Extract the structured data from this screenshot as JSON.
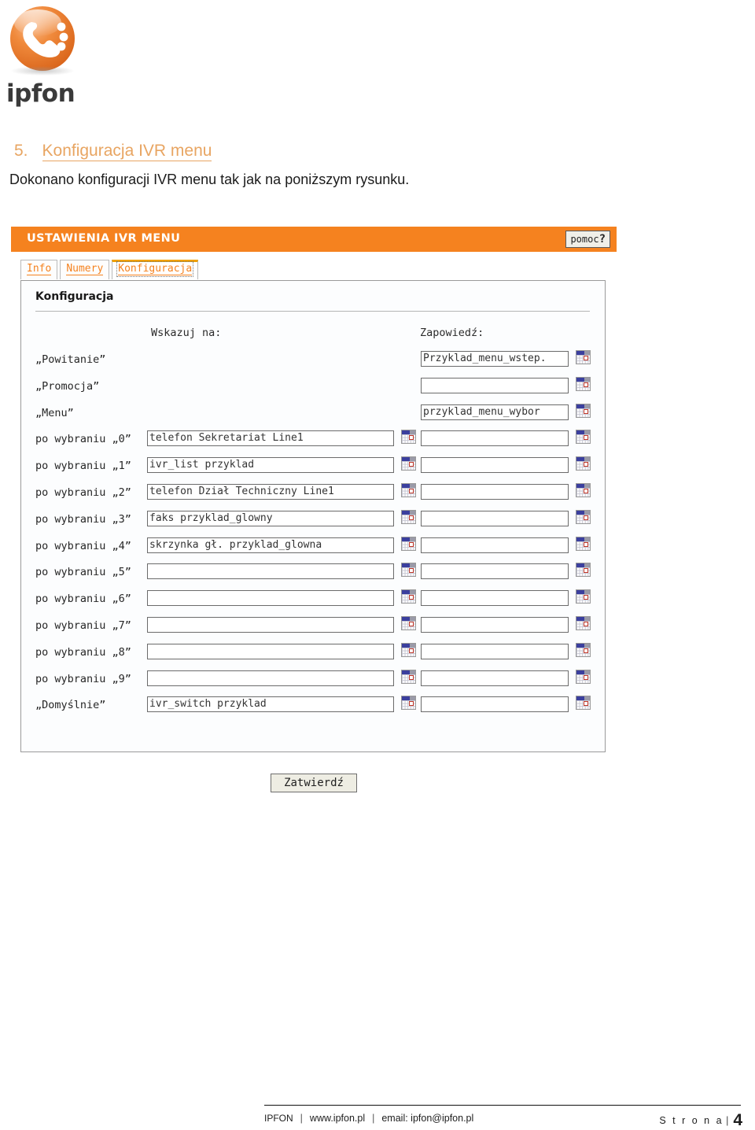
{
  "document": {
    "logo": {
      "wordmark": "ipfon",
      "icon": "ipfon-phone-sphere-logo"
    },
    "section": {
      "number": "5.",
      "title": "Konfiguracja IVR menu",
      "paragraph": "Dokonano konfiguracji IVR menu tak jak na poniższym rysunku.",
      "accent_color": "#e8a562"
    },
    "footer": {
      "brand": "IPFON",
      "website": "www.ipfon.pl",
      "email": "email: ipfon@ipfon.pl",
      "separator": "|",
      "page_label": "S t r o n a",
      "page_number": "4"
    }
  },
  "app": {
    "titlebar": {
      "title": "USTAWIENIA IVR MENU",
      "background_color": "#f5821f",
      "help_label": "pomoc",
      "help_glyph": "?"
    },
    "tabs": [
      {
        "label": "Info",
        "active": false
      },
      {
        "label": "Numery",
        "active": false
      },
      {
        "label": "Konfiguracja",
        "active": true
      }
    ],
    "panel": {
      "heading": "Konfiguracja",
      "columns": {
        "target": "Wskazuj na:",
        "prompt": "Zapowiedź:"
      },
      "picker_icon": "calendar-picker-icon",
      "rows": [
        {
          "label": "„Powitanie”",
          "target": "",
          "target_picker": false,
          "prompt": "Przyklad_menu_wstep.",
          "prompt_picker": true
        },
        {
          "label": "„Promocja”",
          "target": "",
          "target_picker": false,
          "prompt": "",
          "prompt_picker": true
        },
        {
          "label": "„Menu”",
          "target": "",
          "target_picker": false,
          "prompt": "przyklad_menu_wybor",
          "prompt_picker": true
        },
        {
          "label": "po wybraniu „0”",
          "target": "telefon Sekretariat Line1",
          "target_picker": true,
          "prompt": "",
          "prompt_picker": true
        },
        {
          "label": "po wybraniu „1”",
          "target": "ivr_list przyklad",
          "target_picker": true,
          "prompt": "",
          "prompt_picker": true
        },
        {
          "label": "po wybraniu „2”",
          "target": "telefon Dział Techniczny Line1",
          "target_picker": true,
          "prompt": "",
          "prompt_picker": true
        },
        {
          "label": "po wybraniu „3”",
          "target": "faks przyklad_glowny",
          "target_picker": true,
          "prompt": "",
          "prompt_picker": true
        },
        {
          "label": "po wybraniu „4”",
          "target": "skrzynka gł. przyklad_glowna",
          "target_picker": true,
          "prompt": "",
          "prompt_picker": true
        },
        {
          "label": "po wybraniu „5”",
          "target": "",
          "target_picker": true,
          "prompt": "",
          "prompt_picker": true
        },
        {
          "label": "po wybraniu „6”",
          "target": "",
          "target_picker": true,
          "prompt": "",
          "prompt_picker": true
        },
        {
          "label": "po wybraniu „7”",
          "target": "",
          "target_picker": true,
          "prompt": "",
          "prompt_picker": true
        },
        {
          "label": "po wybraniu „8”",
          "target": "",
          "target_picker": true,
          "prompt": "",
          "prompt_picker": true
        },
        {
          "label": "po wybraniu „9”",
          "target": "",
          "target_picker": true,
          "prompt": "",
          "prompt_picker": true
        },
        {
          "label": "„Domyślnie”",
          "target": "ivr_switch przyklad",
          "target_picker": true,
          "prompt": "",
          "prompt_picker": true
        }
      ]
    },
    "submit_label": "Zatwierdź"
  }
}
